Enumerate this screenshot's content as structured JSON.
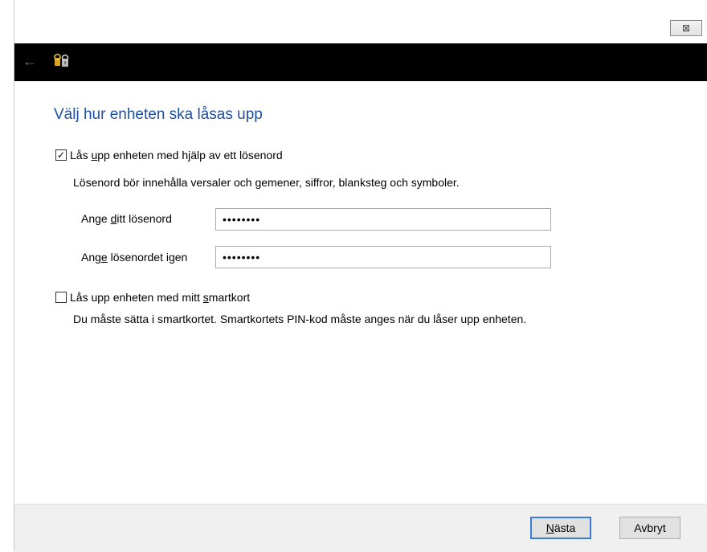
{
  "titlebar": {
    "close_symbol": "⊠"
  },
  "nav": {
    "back_symbol": "←"
  },
  "heading": "Välj hur enheten ska låsas upp",
  "password_option": {
    "checked": true,
    "label_pre": "Lås ",
    "label_ul": "u",
    "label_post": "pp enheten med hjälp av ett lösenord",
    "description": "Lösenord bör innehålla versaler och gemener, siffror, blanksteg och symboler.",
    "enter_label_pre": "Ange ",
    "enter_label_ul": "d",
    "enter_label_post": "itt lösenord",
    "enter_value": "••••••••",
    "repeat_label_pre": "Ang",
    "repeat_label_ul": "e",
    "repeat_label_post": " lösenordet igen",
    "repeat_value": "••••••••"
  },
  "smartcard_option": {
    "checked": false,
    "label_pre": "Lås upp enheten med mitt ",
    "label_ul": "s",
    "label_post": "martkort",
    "description": "Du måste sätta i smartkortet. Smartkortets PIN-kod måste anges när du låser upp enheten."
  },
  "buttons": {
    "next_ul": "N",
    "next_post": "ästa",
    "cancel": "Avbryt"
  },
  "colors": {
    "heading": "#1f4fa0",
    "navbar": "#000000",
    "footer": "#f0f0f0"
  }
}
